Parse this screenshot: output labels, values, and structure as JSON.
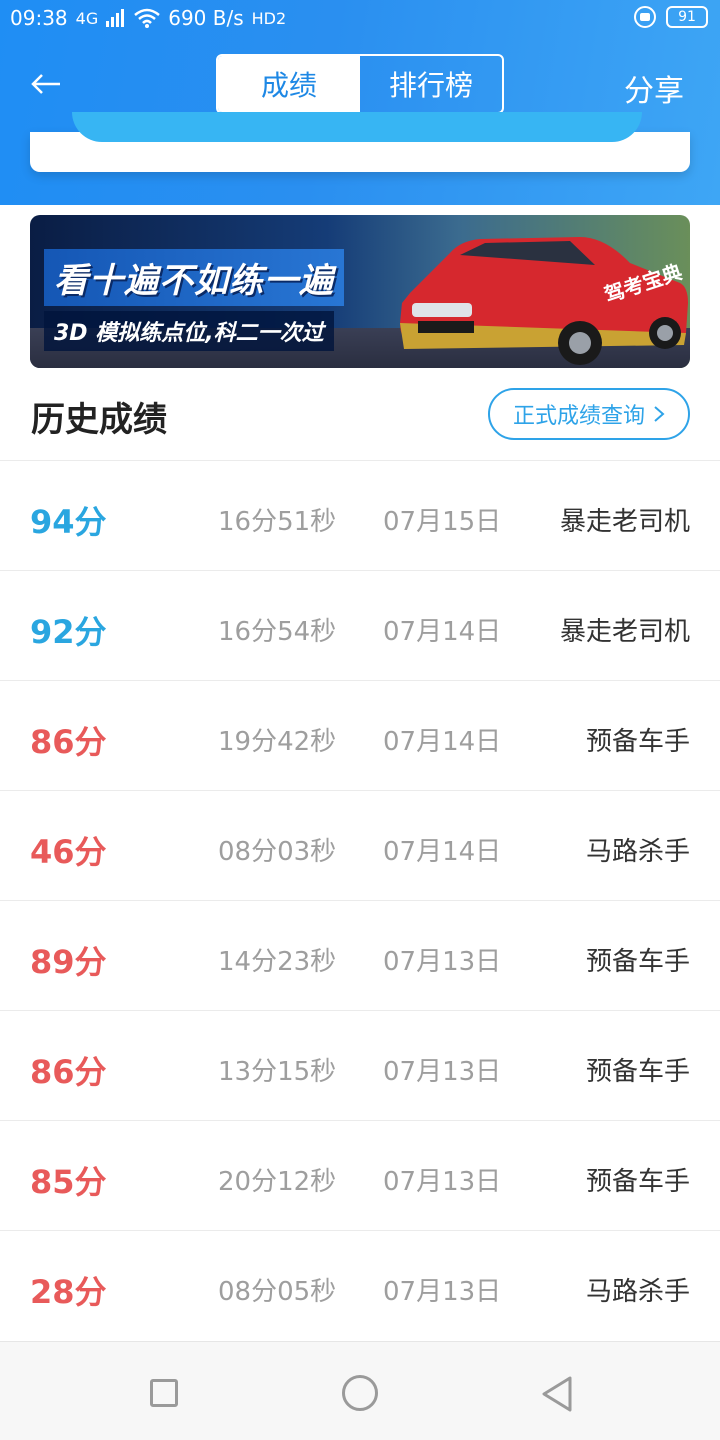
{
  "status_bar": {
    "time": "09:38",
    "network": "4G",
    "speed": "690 B/s",
    "hd": "HD2",
    "battery": "91"
  },
  "header": {
    "back_icon": "arrow-left-icon",
    "tabs": [
      {
        "label": "成绩",
        "active": true
      },
      {
        "label": "排行榜",
        "active": false
      }
    ],
    "share_label": "分享"
  },
  "banner": {
    "headline": "看十遍不如练一遍",
    "subline": "3D 模拟练点位,科二一次过",
    "car_text": "驾考宝典"
  },
  "history": {
    "title": "历史成绩",
    "query_button": "正式成绩查询",
    "rows": [
      {
        "score": "94分",
        "duration": "16分51秒",
        "date": "07月15日",
        "title": "暴走老司机",
        "color": "#2aa6e0"
      },
      {
        "score": "92分",
        "duration": "16分54秒",
        "date": "07月14日",
        "title": "暴走老司机",
        "color": "#2aa6e0"
      },
      {
        "score": "86分",
        "duration": "19分42秒",
        "date": "07月14日",
        "title": "预备车手",
        "color": "#e85a5a"
      },
      {
        "score": "46分",
        "duration": "08分03秒",
        "date": "07月14日",
        "title": "马路杀手",
        "color": "#e85a5a"
      },
      {
        "score": "89分",
        "duration": "14分23秒",
        "date": "07月13日",
        "title": "预备车手",
        "color": "#e85a5a"
      },
      {
        "score": "86分",
        "duration": "13分15秒",
        "date": "07月13日",
        "title": "预备车手",
        "color": "#e85a5a"
      },
      {
        "score": "85分",
        "duration": "20分12秒",
        "date": "07月13日",
        "title": "预备车手",
        "color": "#e85a5a"
      },
      {
        "score": "28分",
        "duration": "08分05秒",
        "date": "07月13日",
        "title": "马路杀手",
        "color": "#e85a5a"
      }
    ]
  },
  "colors": {
    "accent": "#1e88e5",
    "good": "#2aa6e0",
    "bad": "#e85a5a"
  }
}
